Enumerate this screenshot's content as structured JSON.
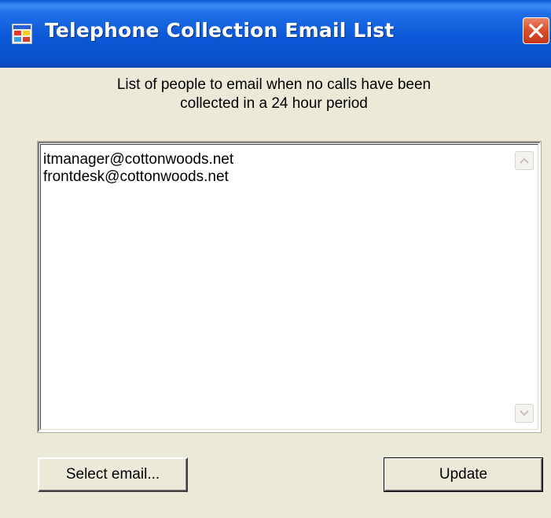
{
  "window": {
    "title": "Telephone Collection Email List",
    "icon": "application-icon",
    "close_icon": "close-icon"
  },
  "instructions": {
    "line1": "List of people to email when no calls have been",
    "line2": "collected in a 24 hour period"
  },
  "email_list": {
    "items": [
      "itmanager@cottonwoods.net",
      "frontdesk@cottonwoods.net"
    ]
  },
  "buttons": {
    "select_email": "Select email...",
    "update": "Update"
  },
  "colors": {
    "titlebar": "#0a58d6",
    "window_bg": "#ece9d8",
    "close_button": "#d9532c"
  }
}
